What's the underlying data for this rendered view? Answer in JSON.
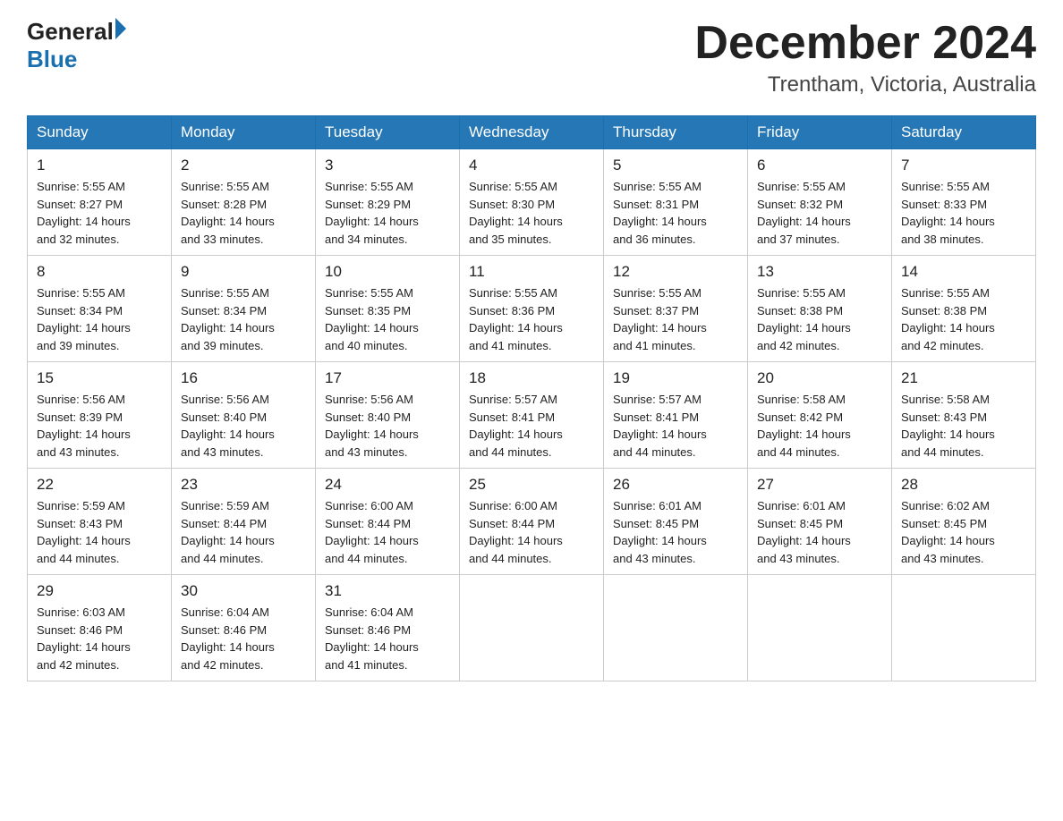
{
  "header": {
    "logo": {
      "line1": "General",
      "arrow": true,
      "line2": "Blue"
    },
    "title": "December 2024",
    "location": "Trentham, Victoria, Australia"
  },
  "calendar": {
    "days_of_week": [
      "Sunday",
      "Monday",
      "Tuesday",
      "Wednesday",
      "Thursday",
      "Friday",
      "Saturday"
    ],
    "weeks": [
      [
        {
          "day": 1,
          "sunrise": "5:55 AM",
          "sunset": "8:27 PM",
          "daylight": "14 hours and 32 minutes."
        },
        {
          "day": 2,
          "sunrise": "5:55 AM",
          "sunset": "8:28 PM",
          "daylight": "14 hours and 33 minutes."
        },
        {
          "day": 3,
          "sunrise": "5:55 AM",
          "sunset": "8:29 PM",
          "daylight": "14 hours and 34 minutes."
        },
        {
          "day": 4,
          "sunrise": "5:55 AM",
          "sunset": "8:30 PM",
          "daylight": "14 hours and 35 minutes."
        },
        {
          "day": 5,
          "sunrise": "5:55 AM",
          "sunset": "8:31 PM",
          "daylight": "14 hours and 36 minutes."
        },
        {
          "day": 6,
          "sunrise": "5:55 AM",
          "sunset": "8:32 PM",
          "daylight": "14 hours and 37 minutes."
        },
        {
          "day": 7,
          "sunrise": "5:55 AM",
          "sunset": "8:33 PM",
          "daylight": "14 hours and 38 minutes."
        }
      ],
      [
        {
          "day": 8,
          "sunrise": "5:55 AM",
          "sunset": "8:34 PM",
          "daylight": "14 hours and 39 minutes."
        },
        {
          "day": 9,
          "sunrise": "5:55 AM",
          "sunset": "8:34 PM",
          "daylight": "14 hours and 39 minutes."
        },
        {
          "day": 10,
          "sunrise": "5:55 AM",
          "sunset": "8:35 PM",
          "daylight": "14 hours and 40 minutes."
        },
        {
          "day": 11,
          "sunrise": "5:55 AM",
          "sunset": "8:36 PM",
          "daylight": "14 hours and 41 minutes."
        },
        {
          "day": 12,
          "sunrise": "5:55 AM",
          "sunset": "8:37 PM",
          "daylight": "14 hours and 41 minutes."
        },
        {
          "day": 13,
          "sunrise": "5:55 AM",
          "sunset": "8:38 PM",
          "daylight": "14 hours and 42 minutes."
        },
        {
          "day": 14,
          "sunrise": "5:55 AM",
          "sunset": "8:38 PM",
          "daylight": "14 hours and 42 minutes."
        }
      ],
      [
        {
          "day": 15,
          "sunrise": "5:56 AM",
          "sunset": "8:39 PM",
          "daylight": "14 hours and 43 minutes."
        },
        {
          "day": 16,
          "sunrise": "5:56 AM",
          "sunset": "8:40 PM",
          "daylight": "14 hours and 43 minutes."
        },
        {
          "day": 17,
          "sunrise": "5:56 AM",
          "sunset": "8:40 PM",
          "daylight": "14 hours and 43 minutes."
        },
        {
          "day": 18,
          "sunrise": "5:57 AM",
          "sunset": "8:41 PM",
          "daylight": "14 hours and 44 minutes."
        },
        {
          "day": 19,
          "sunrise": "5:57 AM",
          "sunset": "8:41 PM",
          "daylight": "14 hours and 44 minutes."
        },
        {
          "day": 20,
          "sunrise": "5:58 AM",
          "sunset": "8:42 PM",
          "daylight": "14 hours and 44 minutes."
        },
        {
          "day": 21,
          "sunrise": "5:58 AM",
          "sunset": "8:43 PM",
          "daylight": "14 hours and 44 minutes."
        }
      ],
      [
        {
          "day": 22,
          "sunrise": "5:59 AM",
          "sunset": "8:43 PM",
          "daylight": "14 hours and 44 minutes."
        },
        {
          "day": 23,
          "sunrise": "5:59 AM",
          "sunset": "8:44 PM",
          "daylight": "14 hours and 44 minutes."
        },
        {
          "day": 24,
          "sunrise": "6:00 AM",
          "sunset": "8:44 PM",
          "daylight": "14 hours and 44 minutes."
        },
        {
          "day": 25,
          "sunrise": "6:00 AM",
          "sunset": "8:44 PM",
          "daylight": "14 hours and 44 minutes."
        },
        {
          "day": 26,
          "sunrise": "6:01 AM",
          "sunset": "8:45 PM",
          "daylight": "14 hours and 43 minutes."
        },
        {
          "day": 27,
          "sunrise": "6:01 AM",
          "sunset": "8:45 PM",
          "daylight": "14 hours and 43 minutes."
        },
        {
          "day": 28,
          "sunrise": "6:02 AM",
          "sunset": "8:45 PM",
          "daylight": "14 hours and 43 minutes."
        }
      ],
      [
        {
          "day": 29,
          "sunrise": "6:03 AM",
          "sunset": "8:46 PM",
          "daylight": "14 hours and 42 minutes."
        },
        {
          "day": 30,
          "sunrise": "6:04 AM",
          "sunset": "8:46 PM",
          "daylight": "14 hours and 42 minutes."
        },
        {
          "day": 31,
          "sunrise": "6:04 AM",
          "sunset": "8:46 PM",
          "daylight": "14 hours and 41 minutes."
        },
        null,
        null,
        null,
        null
      ]
    ],
    "sunrise_label": "Sunrise:",
    "sunset_label": "Sunset:",
    "daylight_label": "Daylight:"
  }
}
